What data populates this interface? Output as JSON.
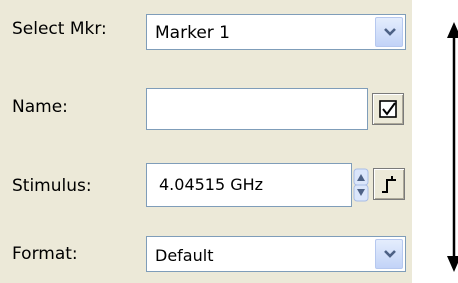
{
  "labels": {
    "select_mkr": "Select Mkr:",
    "name": "Name:",
    "stimulus": "Stimulus:",
    "format": "Format:"
  },
  "select_mkr": {
    "value": "Marker 1"
  },
  "name": {
    "value": ""
  },
  "stimulus": {
    "value": "4.04515 GHz"
  },
  "format": {
    "value": "Default"
  },
  "icons": {
    "dropdown": "chevron-down-icon",
    "name_button": "checkbox-icon",
    "spinner": "up-down-arrows-icon",
    "step_button": "step-icon",
    "resize": "double-arrow-vertical-icon"
  },
  "colors": {
    "panel": "#ece9d8",
    "input_border": "#7f9db9",
    "accent": "#2b5ed3"
  }
}
